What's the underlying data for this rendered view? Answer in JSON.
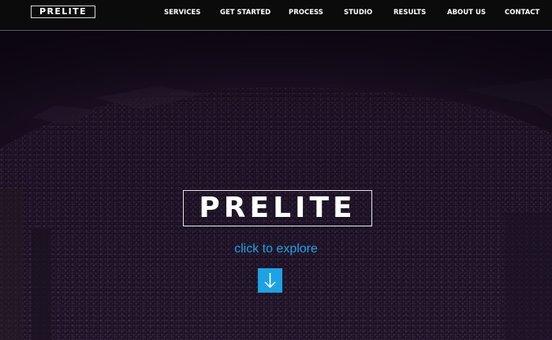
{
  "header": {
    "logo_text": "PRELITE",
    "nav": [
      {
        "label": "SERVICES"
      },
      {
        "label": "GET STARTED"
      },
      {
        "label": "PROCESS"
      },
      {
        "label": "STUDIO"
      },
      {
        "label": "RESULTS"
      },
      {
        "label": "ABOUT US"
      },
      {
        "label": "CONTACT"
      }
    ]
  },
  "hero": {
    "logo_text": "PRELITE",
    "explore_text": "click to explore",
    "explore_icon": "arrow-down-icon"
  },
  "colors": {
    "header_background": "#0b0b0b",
    "accent": "#1ba3e6",
    "hero_tint": "#2a1838"
  }
}
